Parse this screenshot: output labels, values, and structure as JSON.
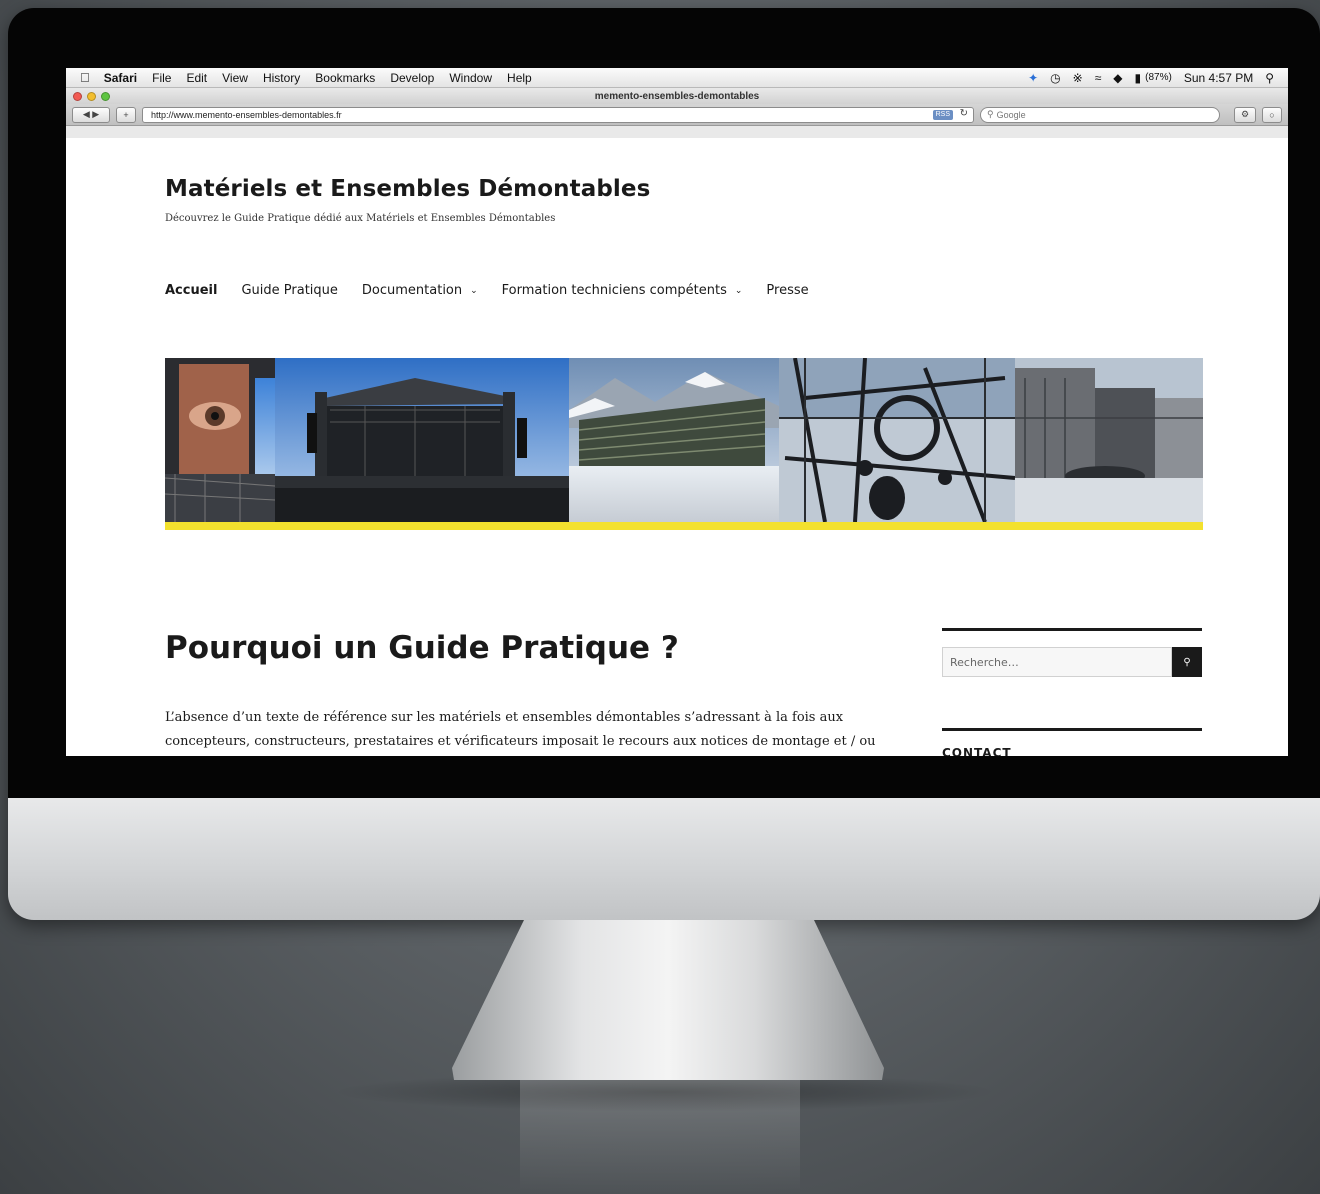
{
  "menubar": {
    "app": "Safari",
    "items": [
      "File",
      "Edit",
      "View",
      "History",
      "Bookmarks",
      "Develop",
      "Window",
      "Help"
    ],
    "battery": "(87%)",
    "clock": "Sun 4:57 PM"
  },
  "window": {
    "title": "memento-ensembles-demontables"
  },
  "toolbar": {
    "url": "http://www.memento-ensembles-demontables.fr",
    "rss": "RSS",
    "search_placeholder": "Google"
  },
  "site": {
    "title": "Matériels et Ensembles Démontables",
    "tagline": "Découvrez le Guide Pratique dédié aux Matériels et Ensembles Démontables"
  },
  "nav": [
    {
      "label": "Accueil",
      "active": true,
      "dropdown": false
    },
    {
      "label": "Guide Pratique",
      "active": false,
      "dropdown": false
    },
    {
      "label": "Documentation",
      "active": false,
      "dropdown": true
    },
    {
      "label": "Formation techniciens compétents",
      "active": false,
      "dropdown": true
    },
    {
      "label": "Presse",
      "active": false,
      "dropdown": false
    }
  ],
  "article": {
    "heading": "Pourquoi un Guide Pratique ?",
    "paragraph": "L’absence d’un texte de référence sur les matériels et ensembles démontables s’adressant à la fois aux concepteurs, constructeurs, prestataires et vérificateurs imposait le recours aux notices de montage et / ou"
  },
  "sidebar": {
    "search_placeholder": "Recherche…",
    "contact_heading": "CONTACT"
  },
  "colors": {
    "accent_yellow": "#f3e12e",
    "text": "#1a1a1a",
    "bezel": "#050505"
  }
}
